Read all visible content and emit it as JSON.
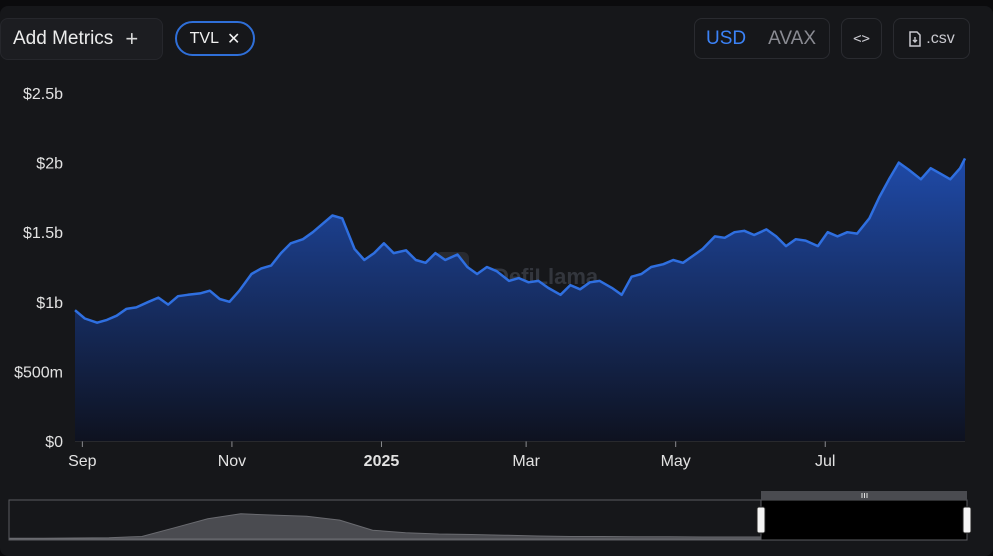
{
  "toolbar": {
    "add_metrics_label": "Add Metrics",
    "metric_chip_label": "TVL",
    "currency_options": [
      "USD",
      "AVAX"
    ],
    "currency_selected": "USD",
    "csv_label": ".csv"
  },
  "watermark": "DefiLlama",
  "colors": {
    "line": "#2f6fe0",
    "area_top": "#1f4aa8",
    "area_bottom": "#0e1220",
    "accent": "#3b82f6"
  },
  "icons": {
    "add": "plus-icon",
    "remove_metric": "close-icon",
    "embed": "code-icon",
    "download": "file-download-icon",
    "range_handle": "grip-icon"
  },
  "chart_data": {
    "type": "area",
    "title": "",
    "xlabel": "",
    "ylabel": "",
    "y_ticks": [
      {
        "label": "$2.5b",
        "value": 2.5
      },
      {
        "label": "$2b",
        "value": 2.0
      },
      {
        "label": "$1.5b",
        "value": 1.5
      },
      {
        "label": "$1b",
        "value": 1.0
      },
      {
        "label": "$500m",
        "value": 0.5
      },
      {
        "label": "$0",
        "value": 0
      }
    ],
    "ylim": [
      0,
      2.5
    ],
    "y_unit": "billion USD",
    "xlim": [
      "2024-08-29",
      "2025-08-27"
    ],
    "x_ticks": [
      {
        "label": "Sep",
        "date": "2024-09-01",
        "bold": false
      },
      {
        "label": "Nov",
        "date": "2024-11-01",
        "bold": false
      },
      {
        "label": "2025",
        "date": "2025-01-01",
        "bold": true
      },
      {
        "label": "Mar",
        "date": "2025-03-01",
        "bold": false
      },
      {
        "label": "May",
        "date": "2025-05-01",
        "bold": false
      },
      {
        "label": "Jul",
        "date": "2025-07-01",
        "bold": false
      }
    ],
    "grid": false,
    "series": [
      {
        "x": [
          "2024-08-29",
          "2024-09-02",
          "2024-09-07",
          "2024-09-11",
          "2024-09-15",
          "2024-09-19",
          "2024-09-23",
          "2024-09-28",
          "2024-10-02",
          "2024-10-06",
          "2024-10-10",
          "2024-10-14",
          "2024-10-19",
          "2024-10-23",
          "2024-10-27",
          "2024-10-31",
          "2024-11-04",
          "2024-11-09",
          "2024-11-13",
          "2024-11-17",
          "2024-11-21",
          "2024-11-25",
          "2024-11-30",
          "2024-12-04",
          "2024-12-08",
          "2024-12-12",
          "2024-12-16",
          "2024-12-21",
          "2024-12-25",
          "2024-12-29",
          "2025-01-02",
          "2025-01-06",
          "2025-01-11",
          "2025-01-15",
          "2025-01-19",
          "2025-01-23",
          "2025-01-27",
          "2025-02-01",
          "2025-02-05",
          "2025-02-09",
          "2025-02-13",
          "2025-02-17",
          "2025-02-22",
          "2025-02-26",
          "2025-03-02",
          "2025-03-06",
          "2025-03-10",
          "2025-03-15",
          "2025-03-19",
          "2025-03-23",
          "2025-03-27",
          "2025-03-31",
          "2025-04-05",
          "2025-04-09",
          "2025-04-13",
          "2025-04-17",
          "2025-04-21",
          "2025-04-26",
          "2025-04-30",
          "2025-05-04",
          "2025-05-08",
          "2025-05-12",
          "2025-05-17",
          "2025-05-21",
          "2025-05-25",
          "2025-05-29",
          "2025-06-02",
          "2025-06-07",
          "2025-06-11",
          "2025-06-15",
          "2025-06-19",
          "2025-06-23",
          "2025-06-28",
          "2025-07-02",
          "2025-07-06",
          "2025-07-10",
          "2025-07-14",
          "2025-07-19",
          "2025-07-23",
          "2025-07-27",
          "2025-07-31",
          "2025-08-04",
          "2025-08-09",
          "2025-08-13",
          "2025-08-17",
          "2025-08-21",
          "2025-08-25",
          "2025-08-27"
        ],
        "y": [
          0.94,
          0.88,
          0.85,
          0.87,
          0.9,
          0.95,
          0.96,
          1.0,
          1.03,
          0.98,
          1.04,
          1.05,
          1.06,
          1.08,
          1.02,
          1.0,
          1.08,
          1.2,
          1.24,
          1.26,
          1.35,
          1.42,
          1.45,
          1.5,
          1.56,
          1.62,
          1.6,
          1.38,
          1.3,
          1.35,
          1.42,
          1.35,
          1.37,
          1.3,
          1.28,
          1.35,
          1.3,
          1.34,
          1.25,
          1.2,
          1.25,
          1.22,
          1.15,
          1.17,
          1.14,
          1.15,
          1.1,
          1.05,
          1.12,
          1.09,
          1.14,
          1.15,
          1.1,
          1.05,
          1.18,
          1.2,
          1.25,
          1.27,
          1.3,
          1.28,
          1.33,
          1.38,
          1.47,
          1.46,
          1.5,
          1.51,
          1.48,
          1.52,
          1.47,
          1.4,
          1.45,
          1.44,
          1.4,
          1.5,
          1.47,
          1.5,
          1.49,
          1.6,
          1.75,
          1.88,
          2.0,
          1.95,
          1.88,
          1.96,
          1.92,
          1.88,
          1.96,
          2.03
        ]
      }
    ]
  }
}
